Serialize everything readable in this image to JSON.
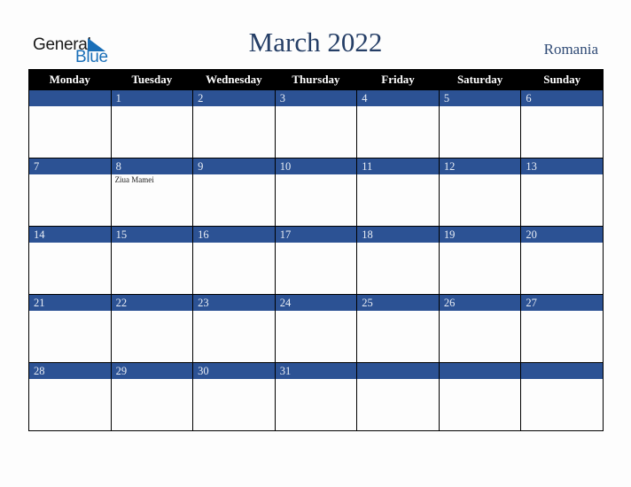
{
  "logo": {
    "line1": "General",
    "line2": "Blue",
    "brand_color": "#1a6fb8"
  },
  "title": "March 2022",
  "country": "Romania",
  "colors": {
    "header_bg": "#000000",
    "daybar_bg": "#2c5294",
    "title": "#253e66"
  },
  "weekdays": [
    "Monday",
    "Tuesday",
    "Wednesday",
    "Thursday",
    "Friday",
    "Saturday",
    "Sunday"
  ],
  "weeks": [
    [
      {
        "day": ""
      },
      {
        "day": "1"
      },
      {
        "day": "2"
      },
      {
        "day": "3"
      },
      {
        "day": "4"
      },
      {
        "day": "5"
      },
      {
        "day": "6"
      }
    ],
    [
      {
        "day": "7"
      },
      {
        "day": "8",
        "event": "Ziua Mamei"
      },
      {
        "day": "9"
      },
      {
        "day": "10"
      },
      {
        "day": "11"
      },
      {
        "day": "12"
      },
      {
        "day": "13"
      }
    ],
    [
      {
        "day": "14"
      },
      {
        "day": "15"
      },
      {
        "day": "16"
      },
      {
        "day": "17"
      },
      {
        "day": "18"
      },
      {
        "day": "19"
      },
      {
        "day": "20"
      }
    ],
    [
      {
        "day": "21"
      },
      {
        "day": "22"
      },
      {
        "day": "23"
      },
      {
        "day": "24"
      },
      {
        "day": "25"
      },
      {
        "day": "26"
      },
      {
        "day": "27"
      }
    ],
    [
      {
        "day": "28"
      },
      {
        "day": "29"
      },
      {
        "day": "30"
      },
      {
        "day": "31"
      },
      {
        "day": ""
      },
      {
        "day": ""
      },
      {
        "day": ""
      }
    ]
  ]
}
